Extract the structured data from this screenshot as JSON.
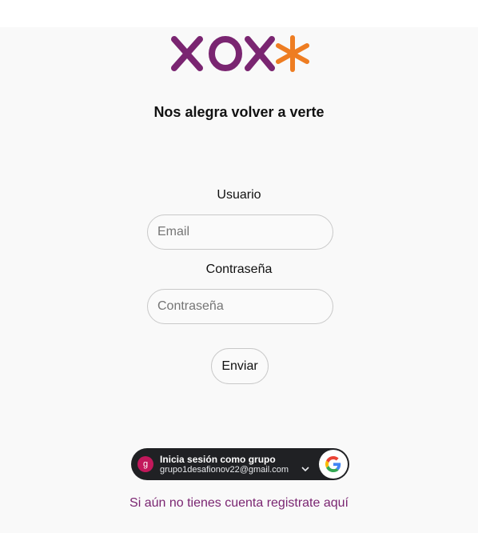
{
  "brand": {
    "logo_text": "XOX*",
    "primary_color": "#7a2571",
    "accent_color": "#ee7d22"
  },
  "login": {
    "headline": "Nos alegra volver a verte",
    "user_label": "Usuario",
    "user_placeholder": "Email",
    "password_label": "Contraseña",
    "password_placeholder": "Contraseña",
    "submit_label": "Enviar"
  },
  "google_signin": {
    "avatar_initial": "g",
    "title": "Inicia sesión como grupo",
    "email": "grupo1desafionov22@gmail.com",
    "icon": "google-g-icon"
  },
  "register_link": "Si aún no tienes cuenta registrate aquí"
}
